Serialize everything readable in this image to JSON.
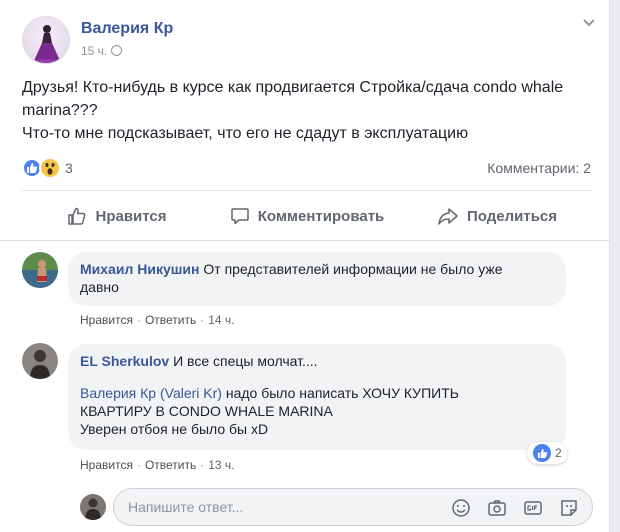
{
  "post": {
    "author": "Валерия Кр",
    "time": "15 ч.",
    "text_line1": "Друзья! Кто-нибудь в курсе как продвигается Стройка/сдача condo whale",
    "text_line2": "marina???",
    "text_line3": "Что-то мне подсказывает, что его не сдадут в эксплуатацию",
    "reactions_count": "3",
    "comments_count": "Комментарии: 2"
  },
  "actions": {
    "like": "Нравится",
    "comment": "Комментировать",
    "share": "Поделиться"
  },
  "comments": [
    {
      "name": "Михаил Никушин",
      "text_line1": "От представителей информации не было уже",
      "text_line2": "давно",
      "like_label": "Нравится",
      "reply_label": "Ответить",
      "time": "14 ч."
    },
    {
      "name": "EL Sherkulov",
      "text_line1": "И все спецы молчат....",
      "mention": "Валерия Кр (Valeri Kr)",
      "text_after_mention": " надо было написать ХОЧУ КУПИТЬ",
      "text_line3": "КВАРТИРУ В CONDO WHALE MARINA",
      "text_line4": "Уверен отбоя не было бы xD",
      "like_label": "Нравится",
      "reply_label": "Ответить",
      "time": "13 ч.",
      "reaction_count": "2"
    }
  ],
  "reply": {
    "placeholder": "Напишите ответ..."
  },
  "colors": {
    "link": "#385898",
    "like_blue": "#4a80f0",
    "wow_yellow": "#f7c544",
    "muted": "#606770"
  },
  "icons": [
    "chevron-down-icon",
    "globe-icon",
    "like-reaction-icon",
    "wow-reaction-icon",
    "thumbs-up-icon",
    "comment-icon",
    "share-icon",
    "emoji-icon",
    "camera-icon",
    "gif-icon",
    "sticker-icon"
  ]
}
